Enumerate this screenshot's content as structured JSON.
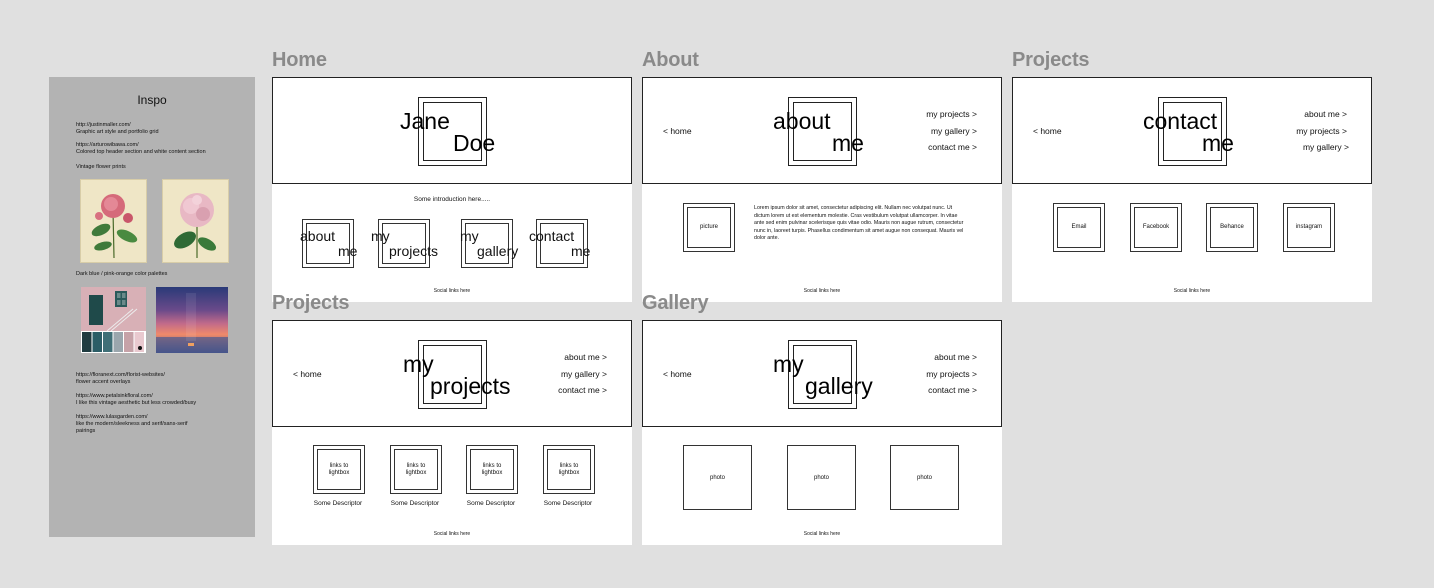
{
  "inspo": {
    "title": "Inspo",
    "notes": [
      "http://justinmaller.com/\nGraphic art style and portfolio grid",
      "https://arturowibawa.com/\nColored top header section and white content section",
      "Vintage flower prints",
      "Dark blue / pink-orange color palettes",
      "https://floranext.com/florist-websites/\nflower accent overlays",
      "https://www.petalsinkfloral.com/\nI like this vintage aesthetic but less crowded/busy",
      "https://www.lulasgarden.com/\nlike the modern/sleekness and serif/sans-serif\npairings"
    ],
    "palette_colors": [
      "#1f3b40",
      "#2b5d66",
      "#3f6f77",
      "#9aa6ad",
      "#c6a2a8",
      "#e9c9cf"
    ],
    "sunset_bands": [
      "#2a3a78",
      "#6a4a8a",
      "#c06a8a",
      "#f08a6a",
      "#f0a060"
    ]
  },
  "frames": {
    "home": {
      "title": "Home",
      "logo_line1": "Jane",
      "logo_line2": "Doe",
      "intro": "Some introduction here.....",
      "tiles": [
        {
          "l1": "about",
          "l2": "me"
        },
        {
          "l1": "my",
          "l2": "projects"
        },
        {
          "l1": "my",
          "l2": "gallery"
        },
        {
          "l1": "contact",
          "l2": "me"
        }
      ],
      "footer": "Social links here"
    },
    "about": {
      "title": "About",
      "logo_line1": "about",
      "logo_line2": "me",
      "back": "< home",
      "nav": [
        "my projects >",
        "my gallery >",
        "contact me >"
      ],
      "picture": "picture",
      "lorem": "Lorem ipsum dolor sit amet, consectetur adipiscing elit. Nullam nec volutpat nunc. Ut dictum lorem ut est elementum molestie. Cras vestibulum volutpat ullamcorper. In vitae ante sed enim pulvinar scelerisque quis vitae odio. Mauris non augue rutrum, consectetur nunc in, laoreet turpis. Phasellus condimentum sit amet augue non consequat. Mauris vel dolor ante.",
      "footer": "Social links here"
    },
    "contact": {
      "title": "Projects",
      "logo_line1": "contact",
      "logo_line2": "me",
      "back": "< home",
      "nav": [
        "about me >",
        "my projects >",
        "my gallery >"
      ],
      "links": [
        "Email",
        "Facebook",
        "Behance",
        "instagram"
      ],
      "footer": "Social links here"
    },
    "projects": {
      "title": "Projects",
      "logo_line1": "my",
      "logo_line2": "projects",
      "back": "< home",
      "nav": [
        "about me >",
        "my gallery >",
        "contact me >"
      ],
      "items": [
        "links to\nlightbox",
        "links to\nlightbox",
        "links to\nlightbox",
        "links to\nlightbox"
      ],
      "descriptors": [
        "Some Descriptor",
        "Some Descriptor",
        "Some Descriptor",
        "Some Descriptor"
      ],
      "footer": "Social links here"
    },
    "gallery": {
      "title": "Gallery",
      "logo_line1": "my",
      "logo_line2": "gallery",
      "back": "< home",
      "nav": [
        "about me >",
        "my projects >",
        "contact me >"
      ],
      "photos": [
        "photo",
        "photo",
        "photo"
      ],
      "footer": "Social links here"
    }
  }
}
